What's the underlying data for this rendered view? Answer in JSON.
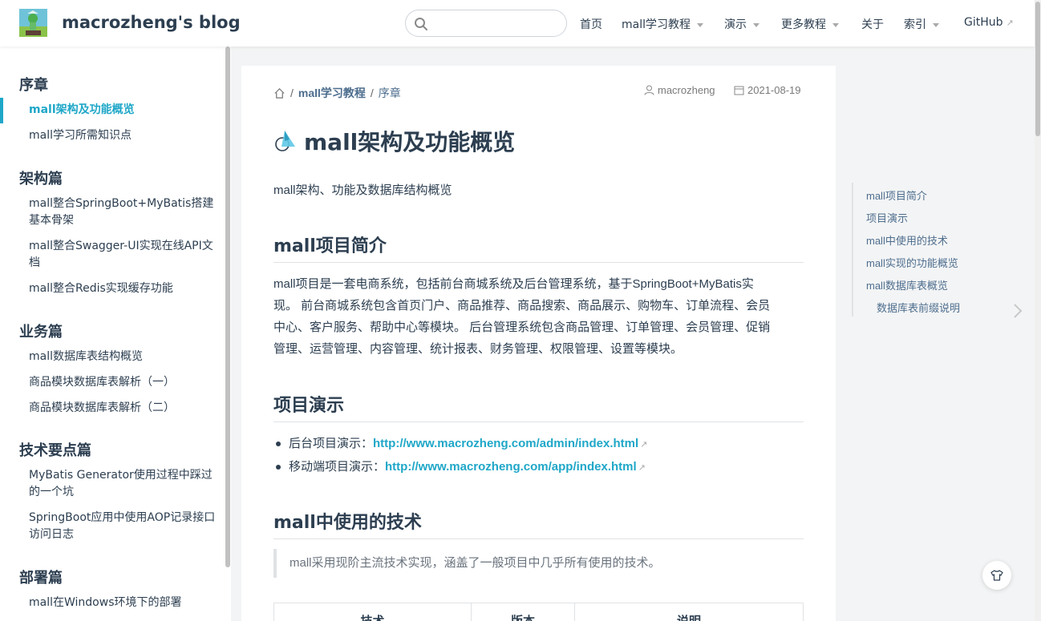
{
  "site": {
    "name": "macrozheng's blog"
  },
  "search": {
    "placeholder": ""
  },
  "nav": {
    "items": [
      {
        "label": "首页",
        "caret": false
      },
      {
        "label": "mall学习教程",
        "caret": true
      },
      {
        "label": "演示",
        "caret": true
      },
      {
        "label": "更多教程",
        "caret": true
      },
      {
        "label": "关于",
        "caret": false
      },
      {
        "label": "索引",
        "caret": true
      },
      {
        "label": "GitHub",
        "external": true
      }
    ]
  },
  "sidebar": {
    "groups": [
      {
        "title": "序章",
        "items": [
          "mall架构及功能概览",
          "mall学习所需知识点"
        ]
      },
      {
        "title": "架构篇",
        "items": [
          "mall整合SpringBoot+MyBatis搭建基本骨架",
          "mall整合Swagger-UI实现在线API文档",
          "mall整合Redis实现缓存功能"
        ]
      },
      {
        "title": "业务篇",
        "items": [
          "mall数据库表结构概览",
          "商品模块数据库表解析（一）",
          "商品模块数据库表解析（二）"
        ]
      },
      {
        "title": "技术要点篇",
        "items": [
          "MyBatis Generator使用过程中踩过的一个坑",
          "SpringBoot应用中使用AOP记录接口访问日志"
        ]
      },
      {
        "title": "部署篇",
        "items": [
          "mall在Windows环境下的部署"
        ]
      }
    ],
    "active": "mall架构及功能概览"
  },
  "breadcrumb": {
    "sep": "/",
    "items": [
      "mall学习教程",
      "序章"
    ]
  },
  "meta": {
    "author": "macrozheng",
    "date": "2021-08-19"
  },
  "article": {
    "title": "mall架构及功能概览",
    "description": "mall架构、功能及数据库结构概览",
    "sections": {
      "intro": "mall项目简介",
      "demo": "项目演示",
      "tech": "mall中使用的技术"
    },
    "intro_lines": [
      "mall项目是一套电商系统，包括前台商城系统及后台管理系统，基于SpringBoot+MyBatis实",
      "现。 前台商城系统包含首页门户、商品推荐、商品搜索、商品展示、购物车、订单流程、会员",
      "中心、客户服务、帮助中心等模块。 后台管理系统包含商品管理、订单管理、会员管理、促销",
      "管理、运营管理、内容管理、统计报表、财务管理、权限管理、设置等模块。"
    ],
    "demo_links": [
      {
        "label": "后台项目演示：",
        "url": "http://www.macrozheng.com/admin/index.html"
      },
      {
        "label": "移动端项目演示：",
        "url": "http://www.macrozheng.com/app/index.html"
      }
    ],
    "tech_quote": "mall采用现阶主流技术实现，涵盖了一般项目中几乎所有使用的技术。",
    "table_headers": [
      "技术",
      "版本",
      "说明"
    ]
  },
  "toc": {
    "items": [
      {
        "label": "mall项目简介",
        "sub": false
      },
      {
        "label": "项目演示",
        "sub": false
      },
      {
        "label": "mall中使用的技术",
        "sub": false
      },
      {
        "label": "mall实现的功能概览",
        "sub": false
      },
      {
        "label": "mall数据库表概览",
        "sub": false
      },
      {
        "label": "数据库表前缀说明",
        "sub": true
      }
    ]
  },
  "colors": {
    "accent": "#1fa7c8",
    "text": "#2c3e50",
    "muted": "#4e6e8e"
  }
}
